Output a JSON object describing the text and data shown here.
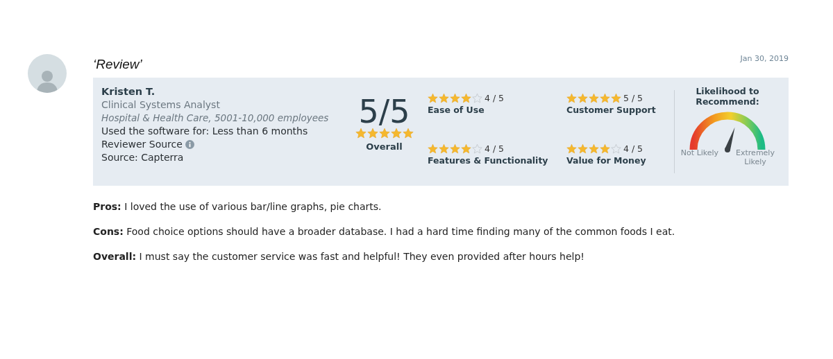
{
  "review": {
    "title": "‘Review’",
    "date": "Jan 30, 2019"
  },
  "reviewer": {
    "name": "Kristen T.",
    "job_title": "Clinical Systems Analyst",
    "industry": "Hospital & Health Care, 5001-10,000 employees",
    "usage": "Used the software for: Less than 6 months",
    "reviewer_source": "Reviewer Source",
    "source": "Source: Capterra"
  },
  "overall": {
    "score": "5/5",
    "stars": 5,
    "label": "Overall"
  },
  "ratings": [
    {
      "label": "Ease of Use",
      "stars": 4,
      "score": "4 / 5"
    },
    {
      "label": "Customer Support",
      "stars": 5,
      "score": "5 / 5"
    },
    {
      "label": "Features & Functionality",
      "stars": 4,
      "score": "4 / 5"
    },
    {
      "label": "Value for Money",
      "stars": 4,
      "score": "4 / 5"
    }
  ],
  "recommend": {
    "title": "Likelihood to Recommend:",
    "low_label": "Not Likely",
    "high_label": "Extremely Likely"
  },
  "paragraphs": [
    "**Pros:** I loved the use of various bar/line graphs, pie charts.",
    "**Cons:** Food choice options should have a broader database. I had a hard time finding many of the common foods I eat.",
    "**Overall:** I must say the customer service was fast and helpful! They even provided after hours help!"
  ]
}
